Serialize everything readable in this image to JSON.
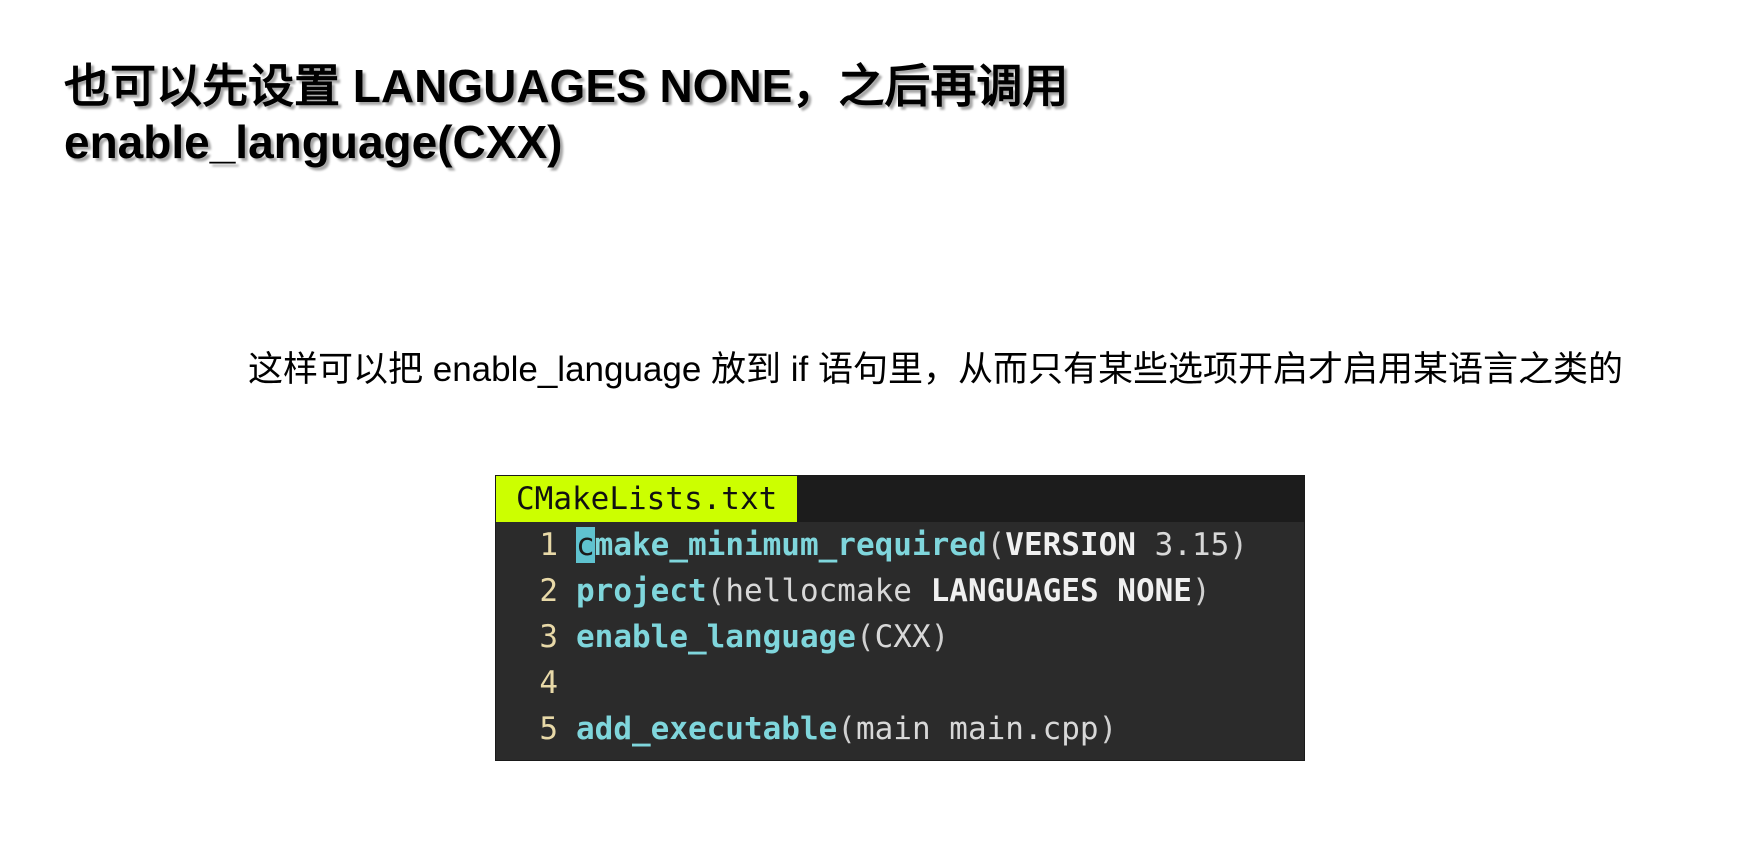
{
  "title": {
    "line1": "也可以先设置 LANGUAGES NONE，之后再调用",
    "line2": "enable_language(CXX)"
  },
  "note": "这样可以把 enable_language 放到 if 语句里，从而只有某些选项开启才启用某语言之类的",
  "editor": {
    "tab_label": "CMakeLists.txt",
    "lines": [
      {
        "number": "1",
        "cursor_char": "c",
        "fn": "make_minimum_required",
        "open": "(",
        "kw": "VERSION",
        "arg": " 3.15",
        "close": ")"
      },
      {
        "number": "2",
        "fn": "project",
        "open": "(",
        "arg": "hellocmake ",
        "kw": "LANGUAGES NONE",
        "close": ")"
      },
      {
        "number": "3",
        "fn": "enable_language",
        "open": "(",
        "arg": "CXX",
        "close": ")"
      },
      {
        "number": "4"
      },
      {
        "number": "5",
        "fn": "add_executable",
        "open": "(",
        "arg": "main main.cpp",
        "close": ")"
      }
    ]
  },
  "colors": {
    "tab_background": "#ccff00",
    "editor_background": "#2b2b2b",
    "function_color": "#7fd6dc",
    "line_number_color": "#e8d9a8"
  }
}
